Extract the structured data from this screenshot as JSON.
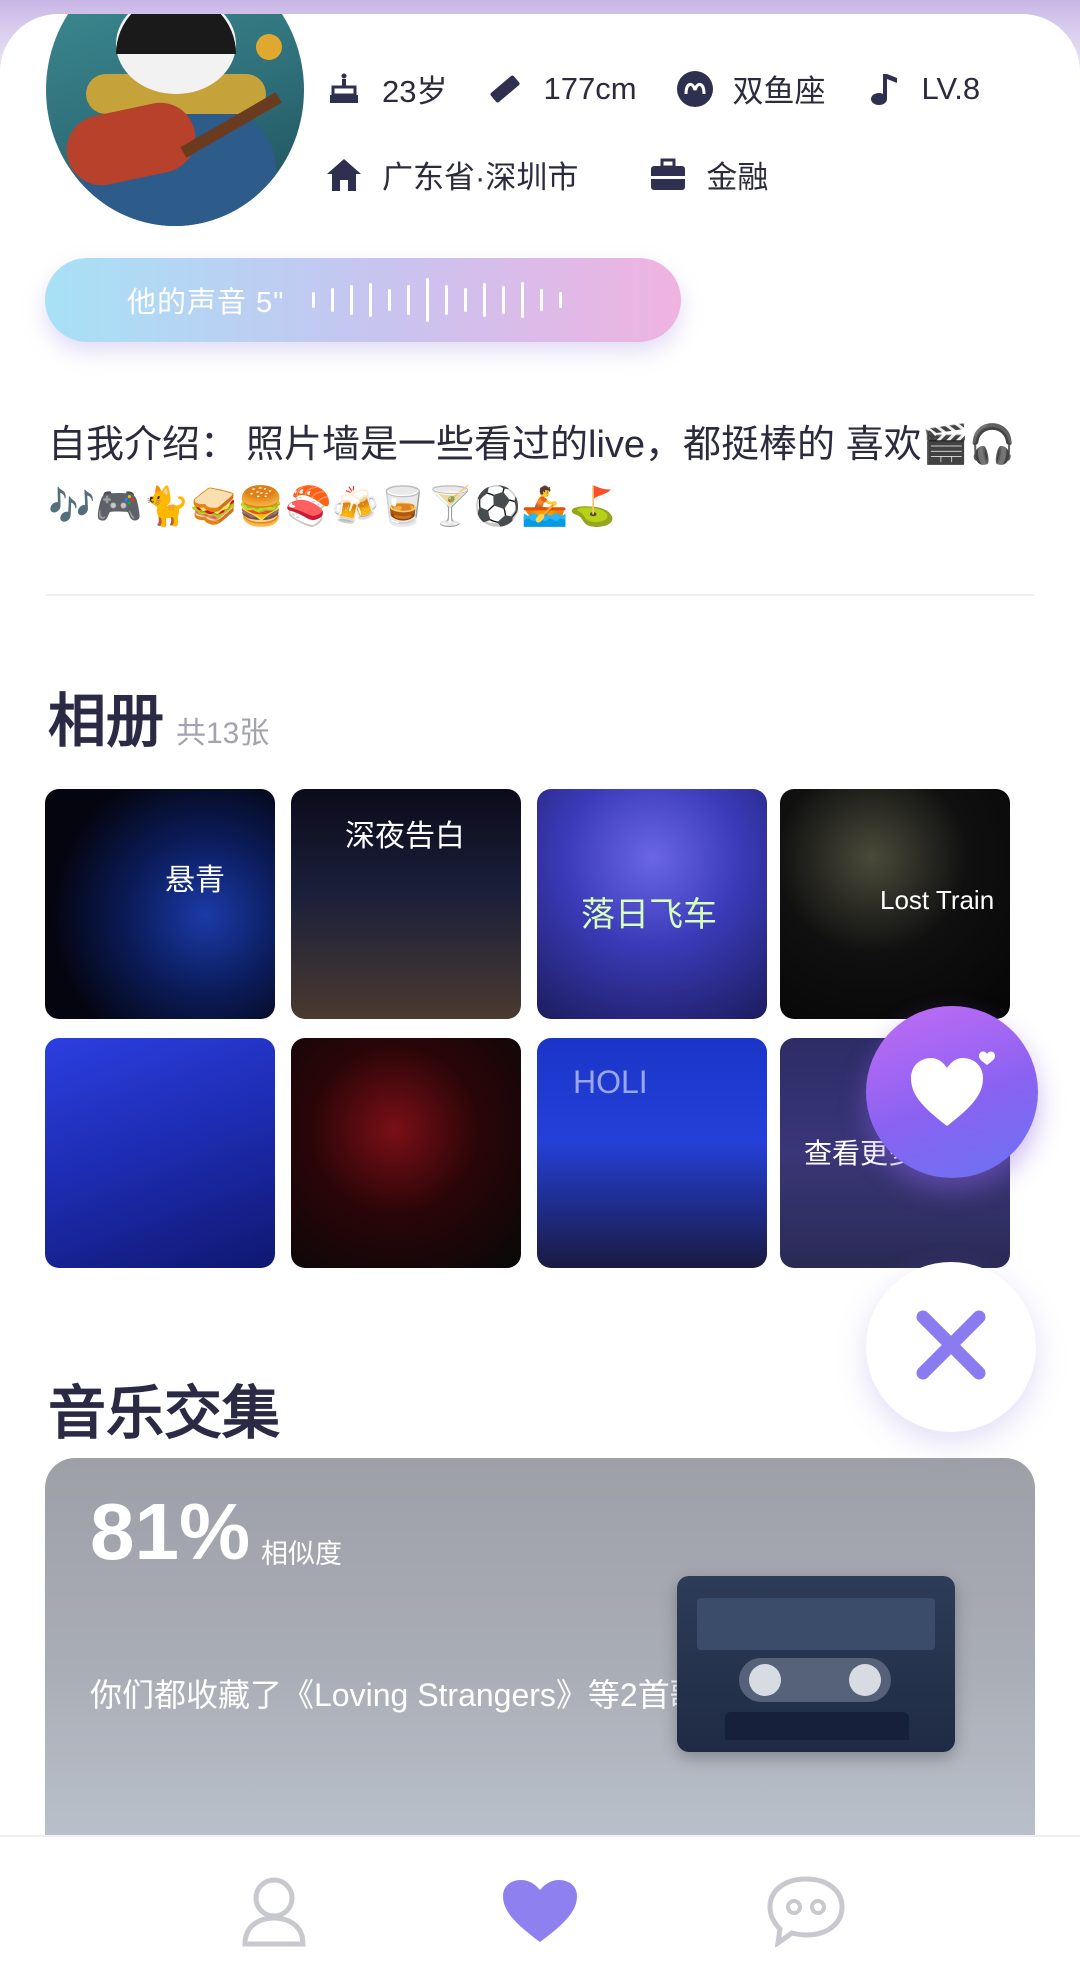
{
  "profile": {
    "age": "23岁",
    "height": "177cm",
    "zodiac": "双鱼座",
    "level": "LV.8",
    "location": "广东省·深圳市",
    "industry": "金融"
  },
  "voice": {
    "label": "他的声音 5\""
  },
  "intro": {
    "label": "自我介绍：",
    "text": "照片墙是一些看过的live，都挺棒的 喜欢🎬🎧🎶🎮🐈🥪🍔🍣🍻🥃🍸⚽🚣⛳"
  },
  "album": {
    "title": "相册",
    "count": "共13张",
    "photos": [
      {
        "caption": "悬青"
      },
      {
        "caption": "深夜告白"
      },
      {
        "caption": "落日飞车"
      },
      {
        "caption": "Lost Train"
      },
      {
        "caption": ""
      },
      {
        "caption": ""
      },
      {
        "caption": "HOLI"
      },
      {
        "caption": ""
      }
    ],
    "more_label": "查看更多"
  },
  "actions": {
    "like_icon": "heart-icon",
    "dismiss_icon": "close-icon"
  },
  "music": {
    "title": "音乐交集",
    "similarity_value": "81%",
    "similarity_label": "相似度",
    "common_text": "你们都收藏了《Loving Strangers》等2首歌"
  },
  "nav": {
    "items": [
      {
        "icon": "person-icon"
      },
      {
        "icon": "heart-icon"
      },
      {
        "icon": "chat-icon"
      }
    ]
  },
  "colors": {
    "accent_purple": "#8a62f2",
    "nav_active": "#8f80f0",
    "nav_inactive": "#c8c8cf",
    "title_text": "#2a2a45"
  }
}
